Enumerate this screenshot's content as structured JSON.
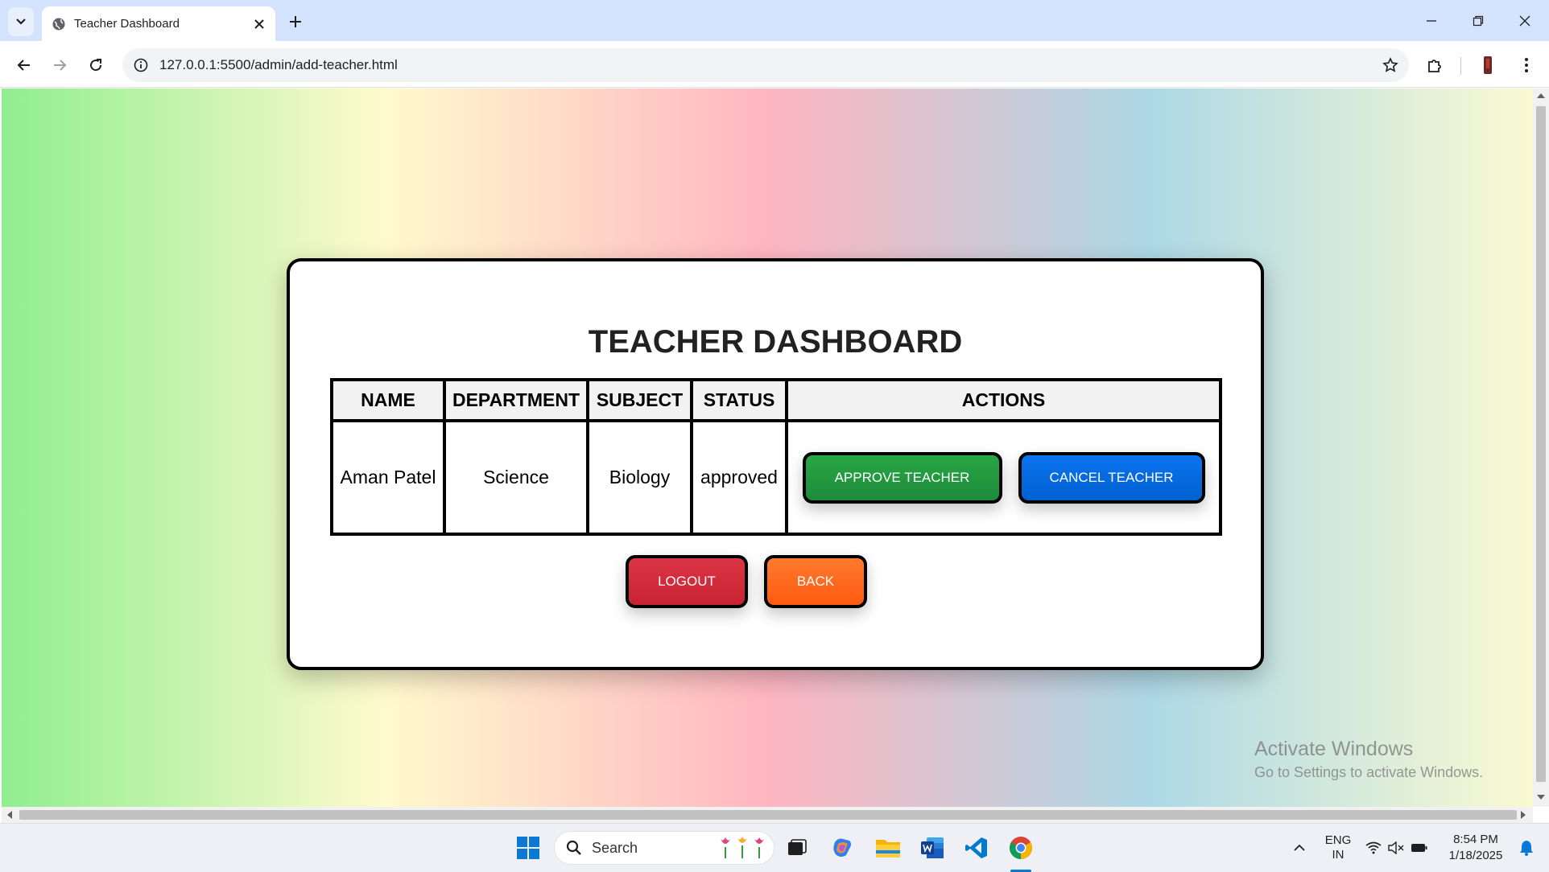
{
  "browser": {
    "tab_title": "Teacher Dashboard",
    "url": "127.0.0.1:5500/admin/add-teacher.html"
  },
  "page": {
    "title": "TEACHER DASHBOARD",
    "table": {
      "headers": [
        "NAME",
        "DEPARTMENT",
        "SUBJECT",
        "STATUS",
        "ACTIONS"
      ],
      "rows": [
        {
          "name": "Aman Patel",
          "department": "Science",
          "subject": "Biology",
          "status": "approved",
          "approve_label": "APPROVE TEACHER",
          "cancel_label": "CANCEL TEACHER"
        }
      ]
    },
    "logout_label": "LOGOUT",
    "back_label": "BACK"
  },
  "watermark": {
    "line1": "Activate Windows",
    "line2": "Go to Settings to activate Windows."
  },
  "taskbar": {
    "search_placeholder": "Search",
    "language": "ENG",
    "region": "IN",
    "time": "8:54 PM",
    "date": "1/18/2025"
  },
  "colors": {
    "approve": "#28a745",
    "cancel": "#0a74f0",
    "logout": "#dc3545",
    "back": "#ff6a20"
  }
}
